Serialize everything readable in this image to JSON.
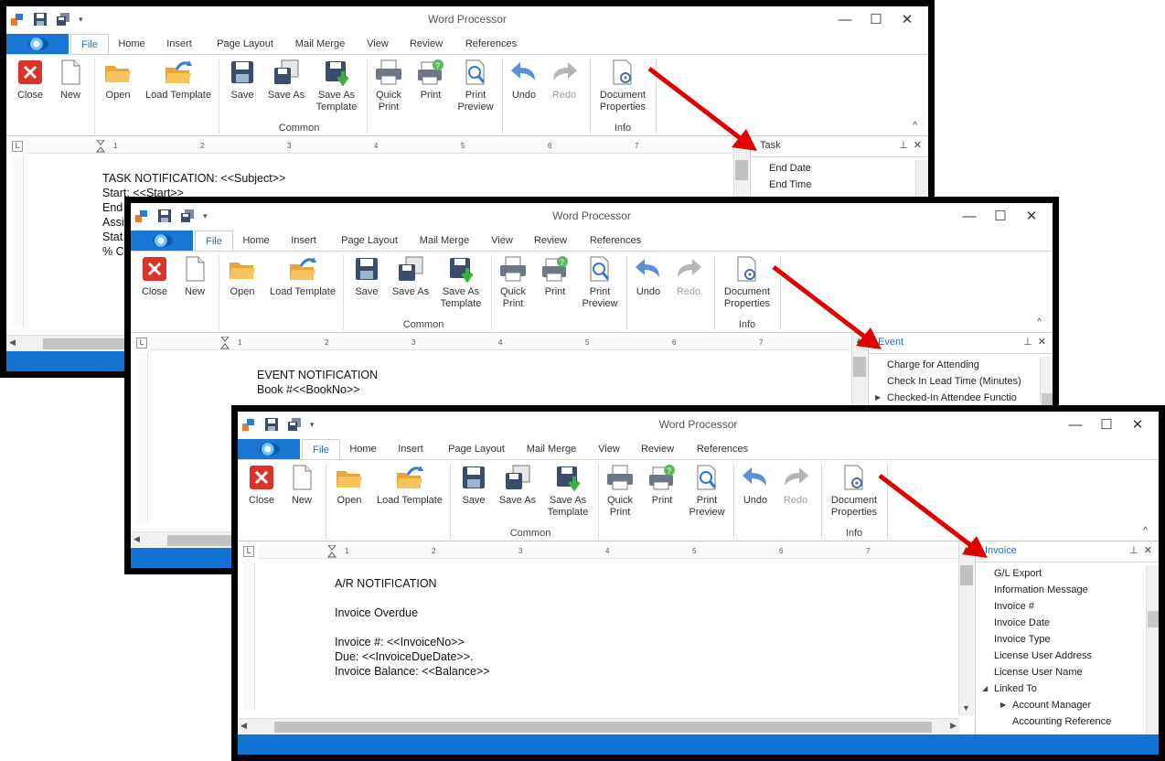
{
  "app_title": "Word Processor",
  "tabs": [
    "File",
    "Home",
    "Insert",
    "Page Layout",
    "Mail Merge",
    "View",
    "Review",
    "References"
  ],
  "window_controls": {
    "minimize": "—",
    "maximize": "☐",
    "close": "✕"
  },
  "qat_more": "▾",
  "ribbon": {
    "close": "Close",
    "new": "New",
    "open": "Open",
    "load_template": "Load Template",
    "save": "Save",
    "save_as": "Save As",
    "save_as_template": "Save As\nTemplate",
    "quick_print": "Quick\nPrint",
    "print": "Print",
    "print_preview": "Print\nPreview",
    "undo": "Undo",
    "redo": "Redo",
    "document_properties": "Document\nProperties",
    "group_common": "Common",
    "group_info": "Info",
    "collapse": "^"
  },
  "ruler_numbers": [
    "1",
    "2",
    "3",
    "4",
    "5",
    "6",
    "7"
  ],
  "ruler_corner": "L",
  "windows": [
    {
      "panel_title": "Task",
      "panel_items": [
        {
          "label": "End Date"
        },
        {
          "label": "End Time"
        }
      ],
      "doc_lines": [
        "TASK NOTIFICATION: <<Subject>>",
        "Start: <<Start>>",
        "End",
        "Assi",
        "Stat",
        "% C"
      ]
    },
    {
      "panel_title": "Event",
      "panel_items": [
        {
          "label": "Charge for Attending"
        },
        {
          "label": "Check In Lead Time (Minutes)"
        },
        {
          "label": "Checked-In Attendee Functio"
        }
      ],
      "doc_lines": [
        "EVENT NOTIFICATION",
        "Book #<<BookNo>>"
      ]
    },
    {
      "panel_title": "Invoice",
      "panel_items": [
        {
          "label": "G/L Export"
        },
        {
          "label": "Information Message"
        },
        {
          "label": "Invoice #"
        },
        {
          "label": "Invoice Date"
        },
        {
          "label": "Invoice Type"
        },
        {
          "label": "License User Address"
        },
        {
          "label": "License User Name"
        },
        {
          "label": "Linked To"
        },
        {
          "label": "Account Manager"
        },
        {
          "label": "Accounting Reference"
        }
      ],
      "doc_lines": [
        "A/R NOTIFICATION",
        "",
        "Invoice Overdue",
        "",
        "Invoice #: <<InvoiceNo>>",
        "Due: <<InvoiceDueDate>>.",
        "Invoice Balance: <<Balance>>"
      ]
    }
  ],
  "colors": {
    "accent": "#1173d4",
    "arrow": "#e00000",
    "tab_active_text": "#1e6fc0"
  }
}
